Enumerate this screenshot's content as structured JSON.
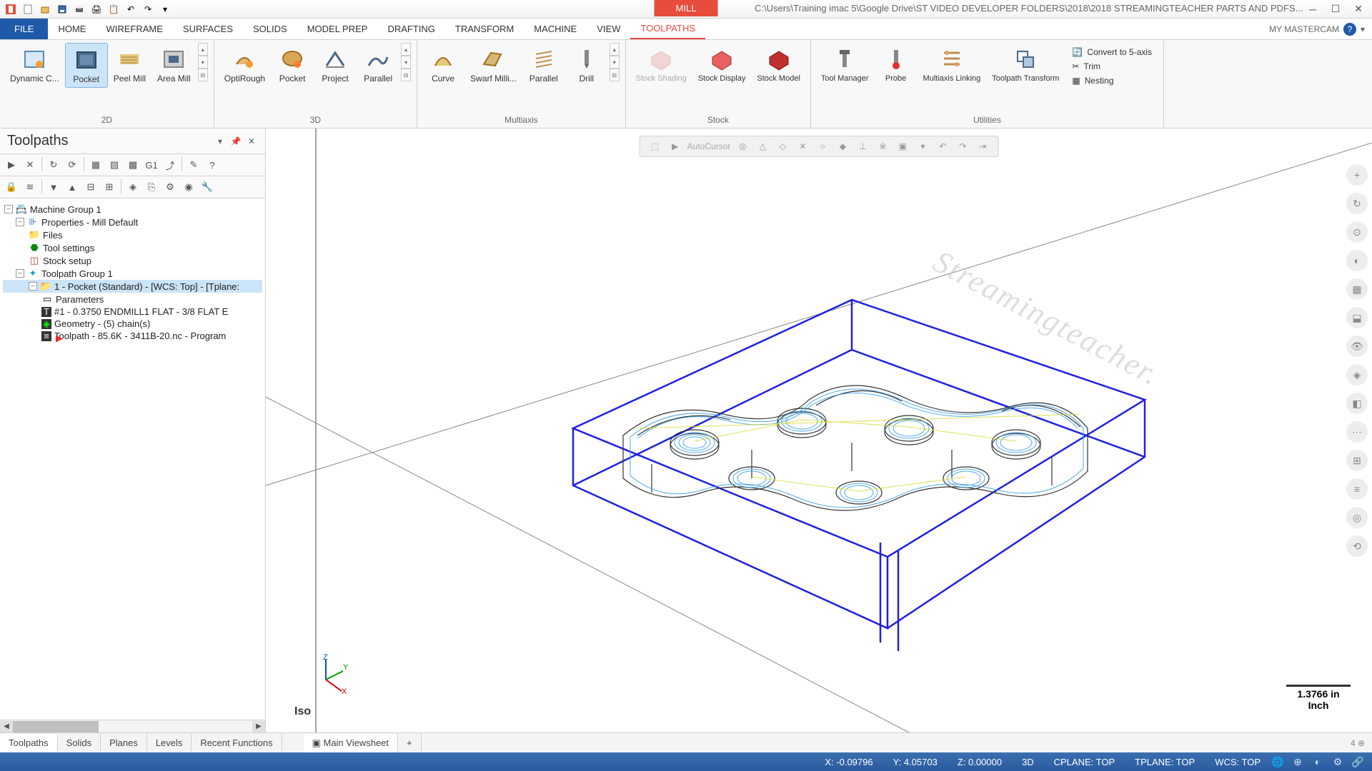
{
  "title": {
    "mill_tab": "MILL",
    "app_path": "C:\\Users\\Training imac 5\\Google Drive\\ST VIDEO DEVELOPER FOLDERS\\2018\\2018 STREAMINGTEACHER PARTS AND PDFS..."
  },
  "menu": {
    "file": "FILE",
    "tabs": [
      "HOME",
      "WIREFRAME",
      "SURFACES",
      "SOLIDS",
      "MODEL PREP",
      "DRAFTING",
      "TRANSFORM",
      "MACHINE",
      "VIEW",
      "TOOLPATHS"
    ],
    "active": "TOOLPATHS",
    "right": "MY MASTERCAM"
  },
  "ribbon": {
    "g2d": {
      "label": "2D",
      "items": [
        "Dynamic C...",
        "Pocket",
        "Peel Mill",
        "Area Mill"
      ],
      "active": "Pocket"
    },
    "g3d": {
      "label": "3D",
      "items": [
        "OptiRough",
        "Pocket",
        "Project",
        "Parallel"
      ]
    },
    "gmulti": {
      "label": "Multiaxis",
      "items": [
        "Curve",
        "Swarf Milli...",
        "Parallel",
        "Drill"
      ]
    },
    "gstock": {
      "label": "Stock",
      "items": [
        "Stock Shading",
        "Stock Display",
        "Stock Model"
      ]
    },
    "gutil": {
      "label": "Utilities",
      "items": [
        "Tool Manager",
        "Probe",
        "Multiaxis Linking",
        "Toolpath Transform"
      ]
    },
    "glist": {
      "items": [
        "Convert to 5-axis",
        "Trim",
        "Nesting"
      ]
    }
  },
  "panel": {
    "title": "Toolpaths",
    "tree": {
      "n1": "Machine Group 1",
      "n2": "Properties - Mill Default",
      "n3": "Files",
      "n4": "Tool settings",
      "n5": "Stock setup",
      "n6": "Toolpath Group 1",
      "n7": "1 - Pocket (Standard) - [WCS: Top] - [Tplane:",
      "n8": "Parameters",
      "n9": "#1 - 0.3750 ENDMILL1 FLAT -   3/8 FLAT E",
      "n10": "Geometry -  (5) chain(s)",
      "n11": "Toolpath - 85.6K - 3411B-20.nc - Program"
    }
  },
  "viewport": {
    "watermark": "Streamingteacher.",
    "view_label": "Iso",
    "scale_value": "1.3766 in",
    "scale_unit": "Inch"
  },
  "bottom_tabs": {
    "left": [
      "Toolpaths",
      "Solids",
      "Planes",
      "Levels",
      "Recent Functions"
    ],
    "active_left": "Toolpaths",
    "right": [
      "Main Viewsheet"
    ],
    "add": "+"
  },
  "status": {
    "x_label": "X:",
    "x_val": "-0.09796",
    "y_label": "Y:",
    "y_val": "4.05703",
    "z_label": "Z:",
    "z_val": "0.00000",
    "mode": "3D",
    "cplane": "CPLANE: TOP",
    "tplane": "TPLANE: TOP",
    "wcs": "WCS: TOP"
  }
}
